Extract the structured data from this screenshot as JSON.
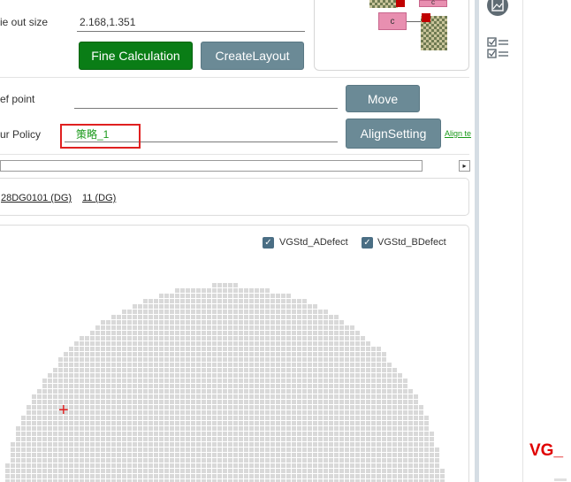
{
  "form": {
    "die_out_size_label": "ie out size",
    "die_out_size_value": "2.168,1.351",
    "ref_point_label": "ef point",
    "policy_label": "ur Policy",
    "policy_value": "策略_1",
    "align_link": "Align te"
  },
  "buttons": {
    "fine_calculation": "Fine Calculation",
    "create_layout": "CreateLayout",
    "move": "Move",
    "align_setting": "AlignSetting"
  },
  "preview": {
    "chip_top": "c",
    "chip_bottom": "c"
  },
  "scroll": {
    "arrow": "▸"
  },
  "die_info": {
    "die_id": "28DG0101 (DG)",
    "count": "11 (DG)"
  },
  "checkboxes": [
    {
      "label": "VGStd_ADefect",
      "checked": true
    },
    {
      "label": "VGStd_BDefect",
      "checked": true
    }
  ],
  "wafer": {
    "cross_marker": "+"
  },
  "right_panel": {
    "vg_label": "VG_"
  },
  "tools": [
    {
      "icon": "layout-image-icon"
    },
    {
      "icon": "checklist-icon"
    }
  ],
  "colors": {
    "green_button": "#0a7d16",
    "gray_button": "#6b8a96",
    "policy_text": "#1a9a1a",
    "highlight": "#e02020",
    "checkbox": "#4a6e84"
  }
}
